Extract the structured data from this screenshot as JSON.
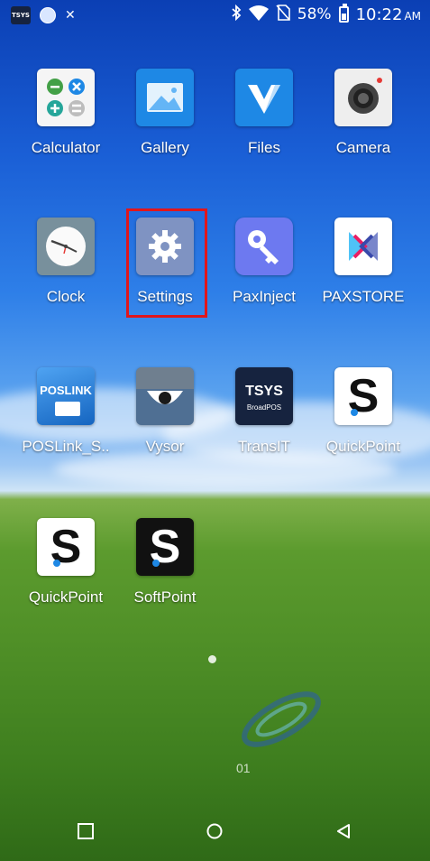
{
  "status_bar": {
    "notification_icons": [
      "tsys-icon",
      "globe-icon",
      "x-icon"
    ],
    "tsys_mini_label": "TSYS",
    "battery_percent": "58%",
    "battery_level": 0.58,
    "time": "10:22",
    "ampm": "AM"
  },
  "apps": [
    {
      "label": "Calculator"
    },
    {
      "label": "Gallery"
    },
    {
      "label": "Files"
    },
    {
      "label": "Camera"
    },
    {
      "label": "Clock"
    },
    {
      "label": "Settings"
    },
    {
      "label": "PaxInject"
    },
    {
      "label": "PAXSTORE"
    },
    {
      "label": "POSLink_S.."
    },
    {
      "label": "Vysor"
    },
    {
      "label": "TransIT"
    },
    {
      "label": "QuickPoint"
    },
    {
      "label": "QuickPoint"
    },
    {
      "label": "SoftPoint"
    }
  ],
  "icon_text": {
    "poslink": "POSLINK",
    "tsys": "TSYS",
    "broadpos": "BroadPOS"
  },
  "watermark_text": "01",
  "colors": {
    "highlight": "#e0161c"
  }
}
